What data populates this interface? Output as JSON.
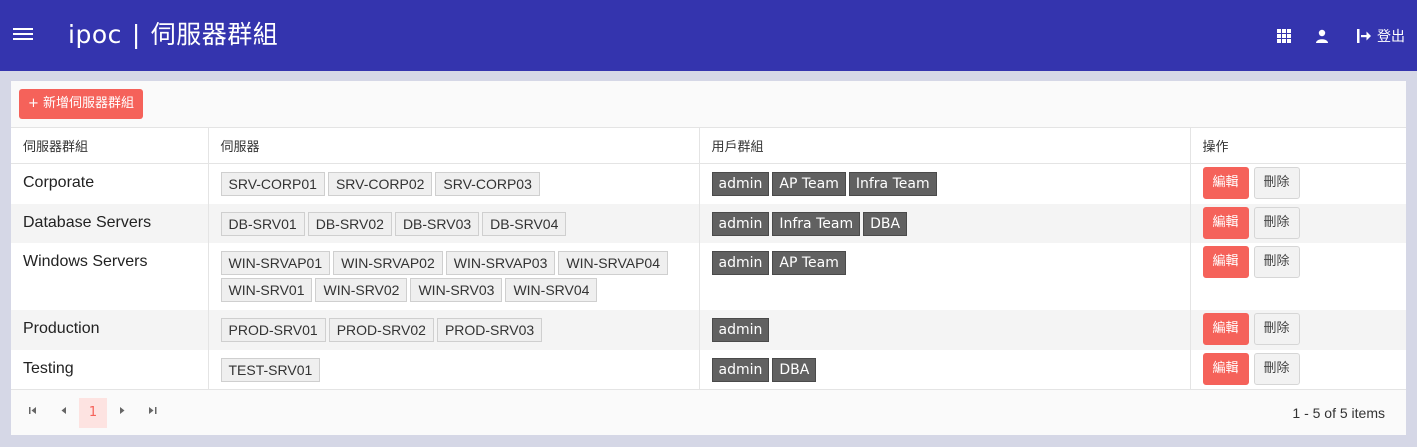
{
  "header": {
    "app_name": "ipoc",
    "separator": "|",
    "page_title": "伺服器群組",
    "logout_label": "登出"
  },
  "toolbar": {
    "add_label": "+ 新增伺服器群組"
  },
  "table": {
    "columns": [
      "伺服器群組",
      "伺服器",
      "用戶群組",
      "操作"
    ],
    "rows": [
      {
        "name": "Corporate",
        "servers": [
          "SRV-CORP01",
          "SRV-CORP02",
          "SRV-CORP03"
        ],
        "user_groups": [
          "admin",
          "AP Team",
          "Infra Team"
        ]
      },
      {
        "name": "Database Servers",
        "servers": [
          "DB-SRV01",
          "DB-SRV02",
          "DB-SRV03",
          "DB-SRV04"
        ],
        "user_groups": [
          "admin",
          "Infra Team",
          "DBA"
        ]
      },
      {
        "name": "Windows Servers",
        "servers": [
          "WIN-SRVAP01",
          "WIN-SRVAP02",
          "WIN-SRVAP03",
          "WIN-SRVAP04",
          "WIN-SRV01",
          "WIN-SRV02",
          "WIN-SRV03",
          "WIN-SRV04"
        ],
        "user_groups": [
          "admin",
          "AP Team"
        ]
      },
      {
        "name": "Production",
        "servers": [
          "PROD-SRV01",
          "PROD-SRV02",
          "PROD-SRV03"
        ],
        "user_groups": [
          "admin"
        ]
      },
      {
        "name": "Testing",
        "servers": [
          "TEST-SRV01"
        ],
        "user_groups": [
          "admin",
          "DBA"
        ]
      }
    ],
    "edit_label": "編輯",
    "delete_label": "刪除"
  },
  "pagination": {
    "current_page": "1",
    "info": "1 - 5 of 5 items"
  },
  "colors": {
    "header_bg": "#3434ae",
    "accent": "#f5625a",
    "user_chip": "#616161"
  },
  "icons": [
    "menu-icon",
    "apps-grid-icon",
    "user-icon",
    "logout-icon",
    "first-page-icon",
    "prev-page-icon",
    "next-page-icon",
    "last-page-icon"
  ]
}
